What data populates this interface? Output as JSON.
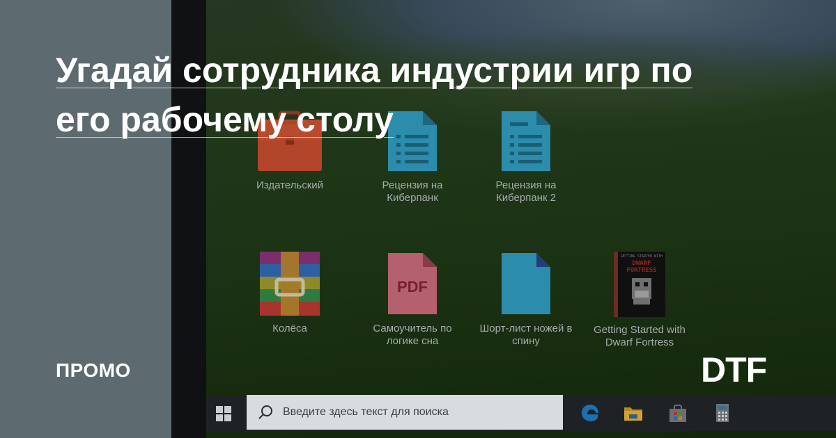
{
  "headline": "Угадай сотрудника индустрии игр по его рабочему столу",
  "headline_lines": [
    "Угадай сотрудника индустрии игр по",
    "его рабочему столу"
  ],
  "label_promo": "ПРОМО",
  "brand": "DTF",
  "colors": {
    "side_panel": "#5d6a6f",
    "headline_text": "#ffffff",
    "desktop_label": "#a6abb0",
    "taskbar": "#1e2224",
    "search_box": "#d9dcdf"
  },
  "desktop": {
    "icons": [
      {
        "label": "Издательский",
        "icon": "briefcase-icon"
      },
      {
        "label": "Рецензия на Киберпанк",
        "icon": "document-icon"
      },
      {
        "label": "Рецензия на Киберпанк 2",
        "icon": "document-icon"
      },
      {
        "label": "Колёса",
        "icon": "winrar-archive-icon"
      },
      {
        "label": "Самоучитель по логике сна",
        "icon": "pdf-file-icon",
        "badge": "PDF"
      },
      {
        "label": "Шорт-лист ножей в спину",
        "icon": "blank-file-icon"
      },
      {
        "label": "Getting Started with Dwarf Fortress",
        "icon": "book-cover-icon",
        "cover_lines": [
          "GETTING STARTED WITH",
          "DWARF",
          "FORTRESS"
        ]
      }
    ]
  },
  "taskbar": {
    "search_placeholder": "Введите здесь текст для поиска",
    "pinned": [
      "edge-browser-icon",
      "file-explorer-icon",
      "store-icon",
      "calculator-icon"
    ]
  }
}
